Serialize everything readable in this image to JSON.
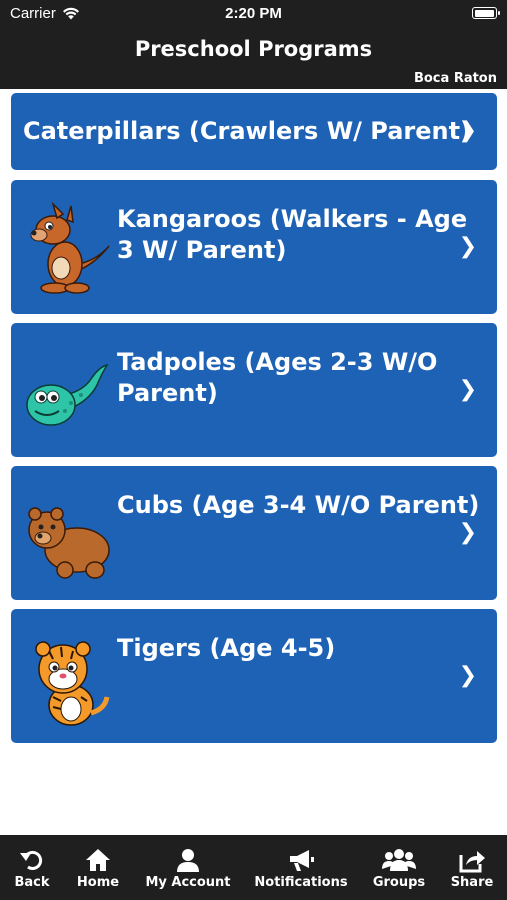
{
  "status": {
    "carrier": "Carrier",
    "time": "2:20 PM"
  },
  "header": {
    "title": "Preschool Programs",
    "location": "Boca Raton"
  },
  "programs": [
    {
      "line1": "Caterpillars (Crawlers W/ Parent)",
      "line2": "",
      "icon": "none"
    },
    {
      "line1": "Kangaroos (Walkers - Age",
      "line2": "3 W/ Parent)",
      "icon": "kangaroo-icon"
    },
    {
      "line1": "Tadpoles (Ages 2-3 W/O",
      "line2": "Parent)",
      "icon": "tadpole-icon"
    },
    {
      "line1": "Cubs (Age 3-4 W/O Parent)",
      "line2": "",
      "icon": "bear-cub-icon"
    },
    {
      "line1": "Tigers (Age 4-5)",
      "line2": "",
      "icon": "tiger-cub-icon"
    }
  ],
  "chevron": "❯",
  "tabs": {
    "back": "Back",
    "home": "Home",
    "account": "My Account",
    "notifications": "Notifications",
    "groups": "Groups",
    "share": "Share"
  },
  "colors": {
    "card": "#1e62b5",
    "bar": "#1f1f1f"
  }
}
